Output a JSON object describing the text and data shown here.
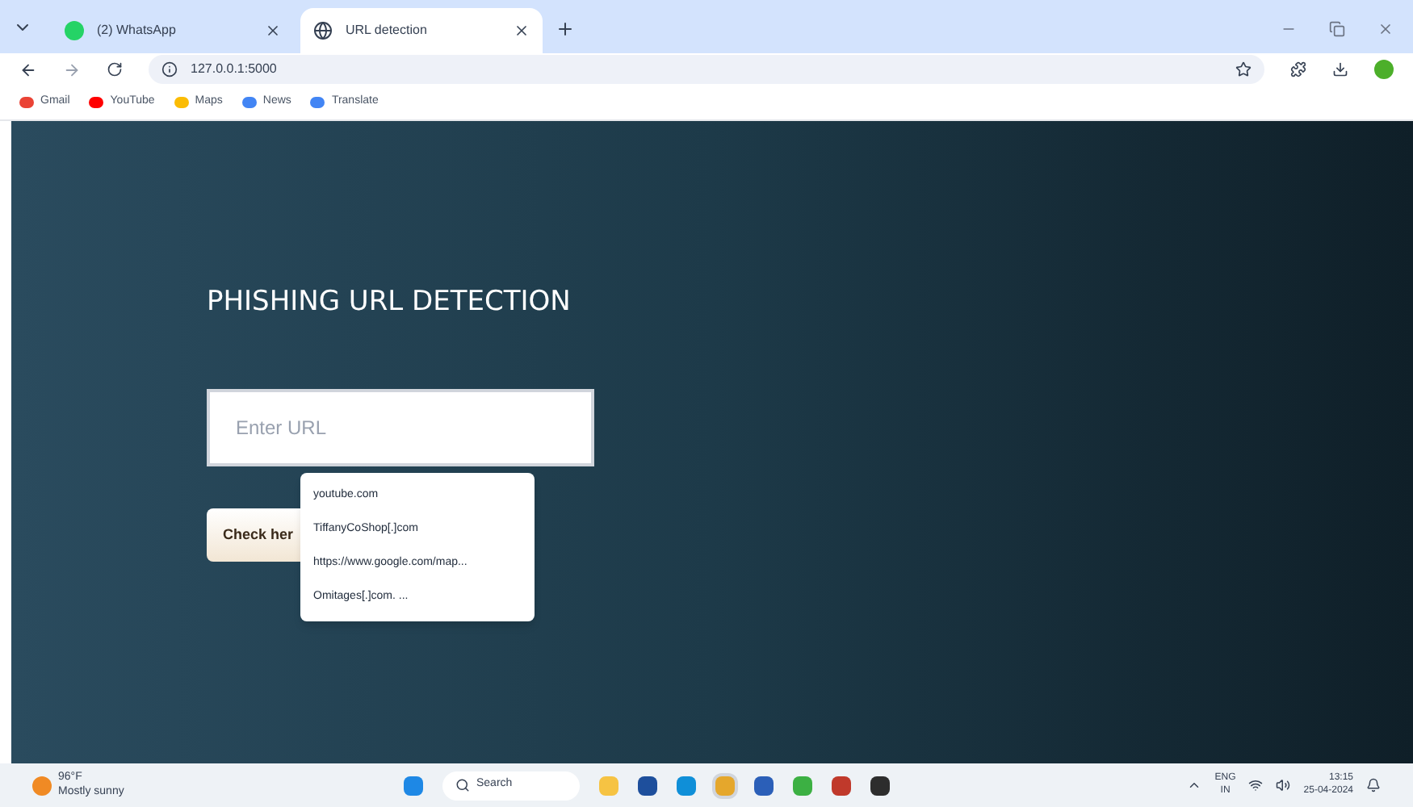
{
  "browser": {
    "tabs": [
      {
        "title": "(2) WhatsApp",
        "kind": "whatsapp",
        "selected": false
      },
      {
        "title": "URL detection",
        "kind": "globe",
        "selected": true
      }
    ],
    "address": "127.0.0.1:5000",
    "bookmarks": [
      {
        "label": "Gmail",
        "kind": "gmail"
      },
      {
        "label": "YouTube",
        "kind": "youtube"
      },
      {
        "label": "Maps",
        "kind": "maps"
      },
      {
        "label": "News",
        "kind": "news"
      },
      {
        "label": "Translate",
        "kind": "translate"
      }
    ]
  },
  "page": {
    "heading": "PHISHING URL DETECTION",
    "url_field": {
      "placeholder": "Enter URL"
    },
    "button": "Check her",
    "suggestions": [
      "youtube.com",
      "TiffanyCoShop[.]com",
      "https://www.google.com/map...",
      "Omitages[.]com. ..."
    ]
  },
  "taskbar": {
    "weather": {
      "temp": "96°F",
      "condition": "Mostly sunny"
    },
    "search": "Search",
    "apps": [
      {
        "kind": "explorer"
      },
      {
        "kind": "store"
      },
      {
        "kind": "edge"
      },
      {
        "kind": "chrome",
        "selected": true
      },
      {
        "kind": "word"
      },
      {
        "kind": "ring"
      },
      {
        "kind": "cs"
      },
      {
        "kind": "terminal"
      }
    ],
    "lang": [
      "ENG",
      "IN"
    ],
    "time": "13:15",
    "date": "25-04-2024"
  }
}
